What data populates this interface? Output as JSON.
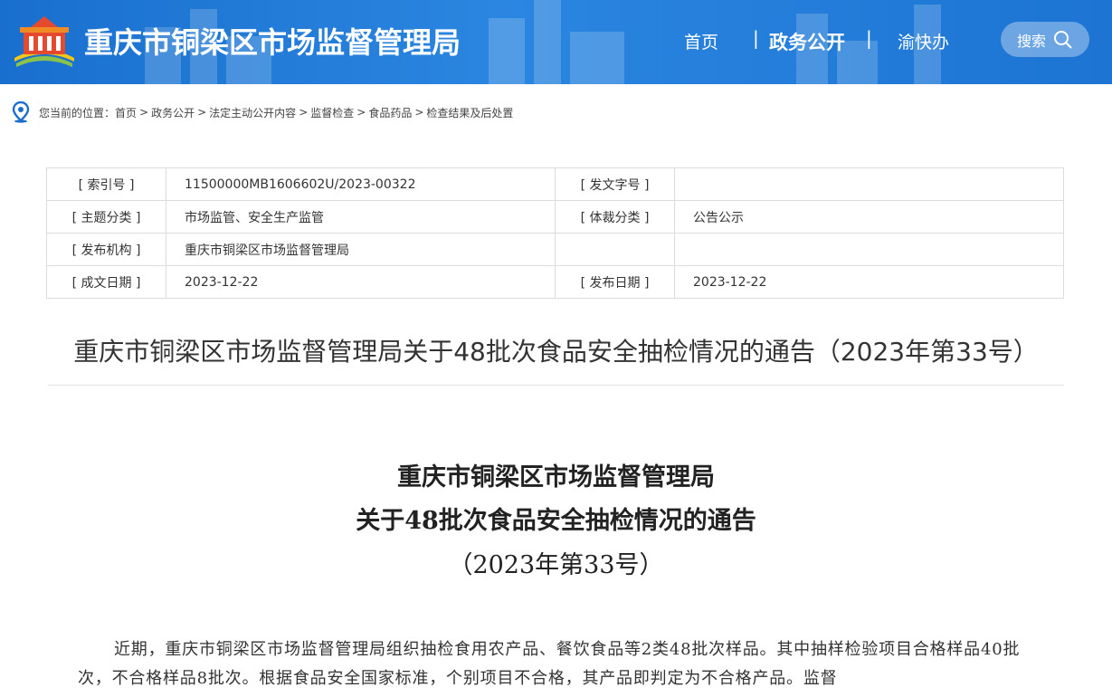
{
  "header": {
    "site_title": "重庆市铜梁区市场监督管理局",
    "nav": {
      "home": "首页",
      "sep": "|",
      "gov_open": "政务公开",
      "yu_kuai_ban": "渝快办"
    },
    "search_label": "搜索",
    "colors": {
      "header_bg": "#1a6fce",
      "text": "#ffffff"
    }
  },
  "breadcrumb": {
    "prefix": "您当前的位置：",
    "items": [
      "首页",
      "政务公开",
      "法定主动公开内容",
      "监督检查",
      "食品药品",
      "检查结果及后处置"
    ],
    "separator": ">"
  },
  "meta": {
    "rows": [
      {
        "k1": "[ 索引号 ]",
        "v1": "11500000MB1606602U/2023-00322",
        "k2": "[ 发文字号 ]",
        "v2": ""
      },
      {
        "k1": "[ 主题分类 ]",
        "v1": "市场监管、安全生产监管",
        "k2": "[ 体裁分类 ]",
        "v2": "公告公示"
      },
      {
        "k1": "[ 发布机构 ]",
        "v1": "重庆市铜梁区市场监督管理局",
        "k2": "",
        "v2": ""
      },
      {
        "k1": "[ 成文日期 ]",
        "v1": "2023-12-22",
        "k2": "[ 发布日期 ]",
        "v2": "2023-12-22"
      }
    ]
  },
  "doc_title": "重庆市铜梁区市场监督管理局关于48批次食品安全抽检情况的通告（2023年第33号）",
  "body": {
    "title_line1": "重庆市铜梁区市场监督管理局",
    "title_line2": "关于48批次食品安全抽检情况的通告",
    "title_line3": "（2023年第33号）",
    "paragraph": "近期，重庆市铜梁区市场监督管理局组织抽检食用农产品、餐饮食品等2类48批次样品。其中抽样检验项目合格样品40批次，不合格样品8批次。根据食品安全国家标准，个别项目不合格，其产品即判定为不合格产品。监督"
  }
}
